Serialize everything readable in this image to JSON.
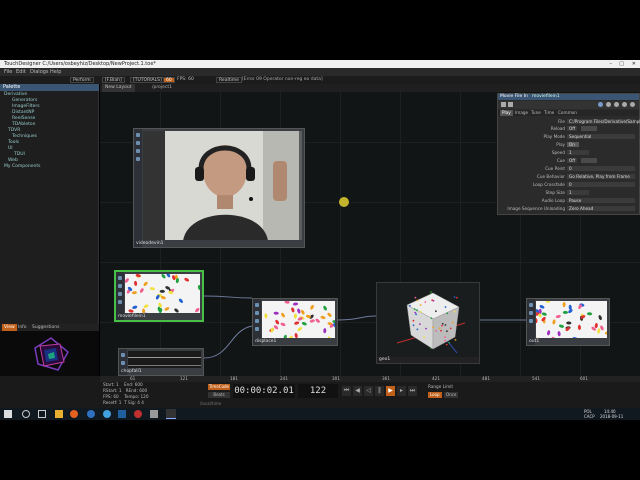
{
  "window": {
    "title": "TouchDesigner C:/Users/osbeyhiz/Desktop/NewProject.1.toe*",
    "controls": [
      "–",
      "□",
      "✕"
    ]
  },
  "menu": [
    "File",
    "Edit",
    "Dialogs",
    "Help"
  ],
  "toolbar": {
    "items": [
      "Perform",
      "[F.Blah]",
      "[TUTORIALS]",
      "60",
      "FPS: 60",
      "Realtime",
      "[Error 09 Operator non-reg eo data]"
    ]
  },
  "nav": {
    "tab": "New Layout",
    "path": "/project1"
  },
  "palette": {
    "title": "Palette",
    "items": [
      "Derivative",
      "Generators",
      "ImageFilters",
      "DistantNP",
      "ReelSense",
      "TDAbleton",
      "TDVR",
      "Techniques",
      "Tools",
      "UI",
      "TDUI",
      "Web",
      "My Components"
    ]
  },
  "info_tabs": [
    "View",
    "Info",
    "Suggestions"
  ],
  "nodes": {
    "webcam": "videodevin1",
    "moviefile": "moviefilein1",
    "chop": "chopfall1",
    "displace": "displace1",
    "geo": "geo1",
    "out": "out1"
  },
  "params": {
    "title": "Movie File In",
    "name": "moviefilein1",
    "tabs": [
      "Play",
      "Image",
      "Tune",
      "Time",
      "Common"
    ],
    "rows": [
      {
        "k": "File",
        "v": "C:/Program Files/Derivative/Samples/Map/00"
      },
      {
        "k": "Reload",
        "v": "Off"
      },
      {
        "k": "Play Mode",
        "v": "Sequential"
      },
      {
        "k": "Play",
        "v": "On"
      },
      {
        "k": "Speed",
        "v": "1"
      },
      {
        "k": "Cue",
        "v": "Off"
      },
      {
        "k": "Cue Point",
        "v": "0"
      },
      {
        "k": "Cue Behavior",
        "v": "Go Relative, Play from Frame"
      },
      {
        "k": "Loop Crossfade",
        "v": "0"
      },
      {
        "k": "Step Size",
        "v": "1"
      },
      {
        "k": "Audio Loop",
        "v": "Pause"
      },
      {
        "k": "Image Sequence Unloading",
        "v": "Zero Ahead"
      }
    ]
  },
  "timeline": {
    "info": [
      [
        "Start:",
        "1",
        "End:",
        "600"
      ],
      [
        "RStart:",
        "1",
        "REnd:",
        "600"
      ],
      [
        "FPS:",
        "60",
        "Tempo:",
        "120"
      ],
      [
        "Resetf:",
        "1",
        "T Sig:",
        "4   4"
      ]
    ],
    "ticks": [
      "61",
      "121",
      "181",
      "241",
      "301",
      "361",
      "421",
      "481",
      "541",
      "601"
    ],
    "timecode": "00:00:02.01",
    "frame": "122",
    "range": "Range Limit",
    "range_opts": [
      "Loop",
      "Once"
    ],
    "mode": "TimeCode",
    "beats": "Beats",
    "path": "/local/time"
  },
  "taskbar": {
    "lang": "POL",
    "time": "14:40",
    "date": "2018-09-11",
    "locale": "CACP"
  }
}
